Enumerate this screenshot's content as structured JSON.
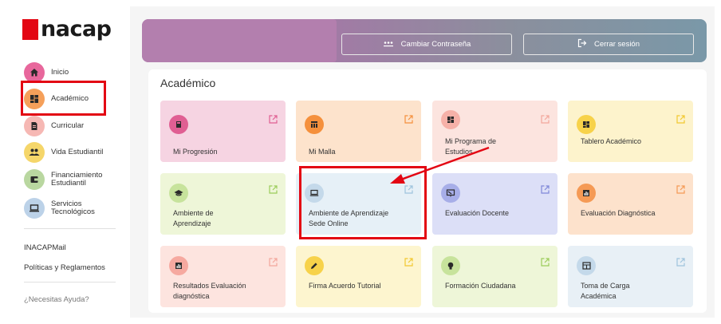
{
  "brand": {
    "logo_text": "nacap"
  },
  "sidebar": {
    "items": [
      {
        "label": "Inicio",
        "icon": "home-icon",
        "color": "#e8679c"
      },
      {
        "label": "Académico",
        "icon": "dashboard-icon",
        "color": "#f5a05a"
      },
      {
        "label": "Curricular",
        "icon": "document-icon",
        "color": "#f6b8b4"
      },
      {
        "label": "Vida Estudiantil",
        "icon": "people-icon",
        "color": "#f5d66a"
      },
      {
        "label": "Financiamiento Estudiantil",
        "icon": "wallet-icon",
        "color": "#b9d7a0"
      },
      {
        "label": "Servicios Tecnológicos",
        "icon": "laptop-icon",
        "color": "#bcd2e8"
      }
    ],
    "links": [
      "INACAPMail",
      "Políticas y Reglamentos"
    ],
    "help": "¿Necesitas Ayuda?"
  },
  "header": {
    "change_password": "Cambiar Contraseña",
    "logout": "Cerrar sesión"
  },
  "section_title": "Académico",
  "cards": [
    {
      "label": "Mi Progresión",
      "bg": "#f6d4e2",
      "icon_bg": "#e05f93",
      "ext": "#e05f93",
      "icon": "book-icon"
    },
    {
      "label": "Mi Malla",
      "bg": "#fde3cc",
      "icon_bg": "#f5903c",
      "ext": "#f5903c",
      "icon": "grid-icon"
    },
    {
      "label": "Mi Programa de Estudios",
      "bg": "#fce4df",
      "icon_bg": "#f6b1a8",
      "ext": "#f3a69c",
      "icon": "dashboard-icon"
    },
    {
      "label": "Tablero Académico",
      "bg": "#fdf3cc",
      "icon_bg": "#f7d24a",
      "ext": "#f2c830",
      "icon": "dashboard-icon"
    },
    {
      "label": "Ambiente de Aprendizaje",
      "bg": "#eef6d8",
      "icon_bg": "#c7e39c",
      "ext": "#9ccc5a",
      "icon": "graduation-cap-icon"
    },
    {
      "label": "Ambiente de Aprendizaje Sede Online",
      "bg": "#e6f0f7",
      "icon_bg": "#c4d9ea",
      "ext": "#9ec3dd",
      "icon": "laptop-icon"
    },
    {
      "label": "Evaluación Docente",
      "bg": "#dcdff7",
      "icon_bg": "#a7aee8",
      "ext": "#7f88d8",
      "icon": "presentation-icon"
    },
    {
      "label": "Evaluación Diagnóstica",
      "bg": "#fde2cc",
      "icon_bg": "#f59a55",
      "ext": "#f59a55",
      "icon": "chart-icon"
    },
    {
      "label": "Resultados Evaluación diagnóstica",
      "bg": "#fde4df",
      "icon_bg": "#f6a9a0",
      "ext": "#f3a69c",
      "icon": "chart-icon"
    },
    {
      "label": "Firma Acuerdo Tutorial",
      "bg": "#fdf5cf",
      "icon_bg": "#f7d24a",
      "ext": "#f2c830",
      "icon": "pen-icon"
    },
    {
      "label": "Formación Ciudadana",
      "bg": "#eef6d8",
      "icon_bg": "#c7e39c",
      "ext": "#9ccc5a",
      "icon": "lightbulb-icon"
    },
    {
      "label": "Toma de Carga Académica",
      "bg": "#e8f0f6",
      "icon_bg": "#c4d9ea",
      "ext": "#9ec3dd",
      "icon": "table-icon"
    }
  ]
}
